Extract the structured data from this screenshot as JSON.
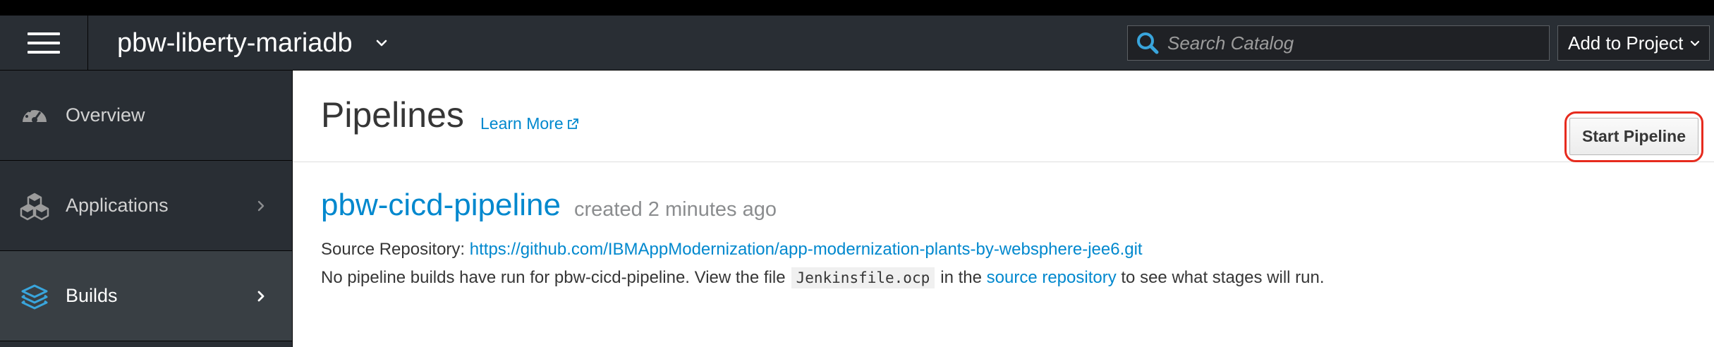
{
  "masthead": {
    "project_name": "pbw-liberty-mariadb",
    "search_placeholder": "Search Catalog",
    "add_to_project_label": "Add to Project"
  },
  "sidebar": {
    "items": [
      {
        "label": "Overview",
        "icon": "dashboard-icon",
        "active": false
      },
      {
        "label": "Applications",
        "icon": "cubes-icon",
        "active": false
      },
      {
        "label": "Builds",
        "icon": "layers-icon",
        "active": true
      }
    ]
  },
  "page": {
    "title": "Pipelines",
    "learn_more_label": "Learn More"
  },
  "pipeline": {
    "name": "pbw-cicd-pipeline",
    "created": "created 2 minutes ago",
    "source_label": "Source Repository:",
    "source_url": "https://github.com/IBMAppModernization/app-modernization-plants-by-websphere-jee6.git",
    "info_prefix": "No pipeline builds have run for pbw-cicd-pipeline. View the file",
    "info_file": "Jenkinsfile.ocp",
    "info_middle": "in the",
    "info_link": "source repository",
    "info_suffix": "to see what stages will run.",
    "start_button_label": "Start Pipeline"
  },
  "colors": {
    "masthead_bg": "#292e34",
    "link": "#0088ce",
    "highlight_ring": "#e62b1e"
  }
}
